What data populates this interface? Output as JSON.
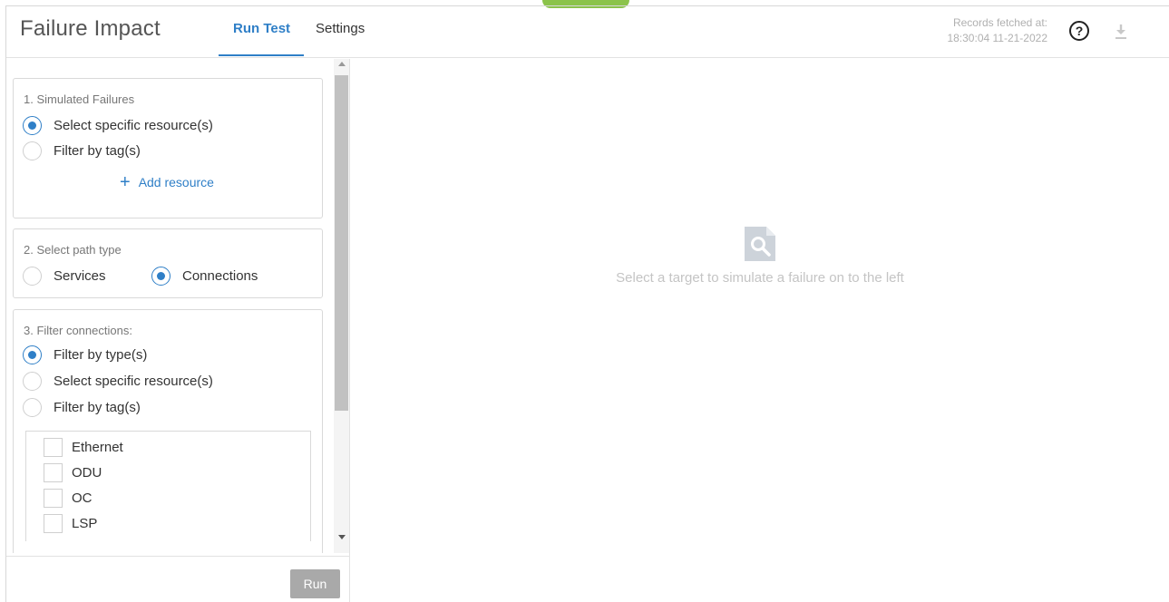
{
  "header": {
    "title": "Failure Impact",
    "tabs": [
      {
        "label": "Run Test",
        "active": true
      },
      {
        "label": "Settings",
        "active": false
      }
    ],
    "records_label": "Records fetched at:",
    "records_time": "18:30:04 11-21-2022"
  },
  "panel": {
    "section1": {
      "title": "1. Simulated Failures",
      "options": [
        {
          "label": "Select specific resource(s)",
          "checked": true
        },
        {
          "label": "Filter by tag(s)",
          "checked": false
        }
      ],
      "add_resource_label": "Add resource"
    },
    "section2": {
      "title": "2. Select path type",
      "options": [
        {
          "label": "Services",
          "checked": false
        },
        {
          "label": "Connections",
          "checked": true
        }
      ]
    },
    "section3": {
      "title": "3. Filter connections:",
      "options": [
        {
          "label": "Filter by type(s)",
          "checked": true
        },
        {
          "label": "Select specific resource(s)",
          "checked": false
        },
        {
          "label": "Filter by tag(s)",
          "checked": false
        }
      ],
      "types": [
        {
          "label": "Ethernet",
          "checked": false
        },
        {
          "label": "ODU",
          "checked": false
        },
        {
          "label": "OC",
          "checked": false
        },
        {
          "label": "LSP",
          "checked": false
        }
      ]
    },
    "run_label": "Run"
  },
  "main": {
    "empty_message": "Select a target to simulate a failure on to the left"
  },
  "colors": {
    "accent": "#2f7fc7",
    "status_pill": "#8bc34a",
    "run_button_disabled": "#a9a9a9"
  },
  "icons": {
    "help": "help-circle-icon",
    "download": "download-icon",
    "empty": "document-search-icon"
  }
}
